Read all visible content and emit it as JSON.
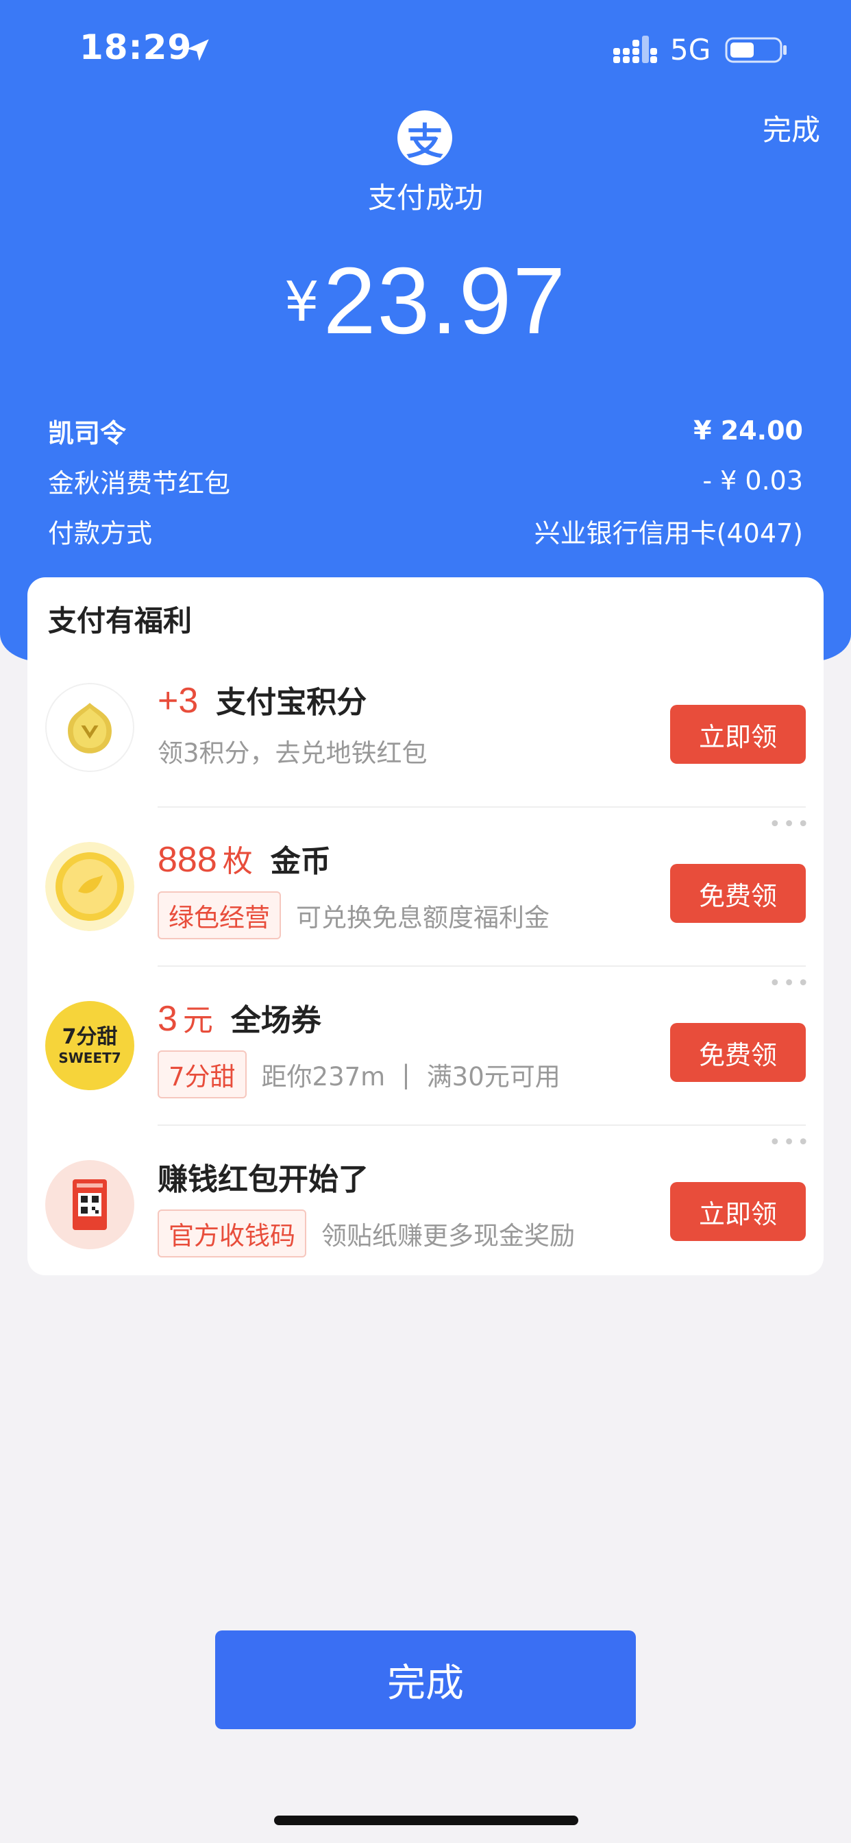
{
  "status_bar": {
    "time": "18:29",
    "network": "5G"
  },
  "header": {
    "done_label": "完成",
    "logo_char": "支",
    "status_text": "支付成功",
    "currency": "¥",
    "amount": "23.97"
  },
  "details": [
    {
      "label": "凯司令",
      "value": "¥ 24.00"
    },
    {
      "label": "金秋消费节红包",
      "value": "- ¥ 0.03"
    },
    {
      "label": "付款方式",
      "value": "兴业银行信用卡(4047)"
    }
  ],
  "benefits": {
    "title": "支付有福利",
    "items": [
      {
        "num": "+3",
        "unit": "",
        "name": "支付宝积分",
        "tag": "",
        "desc": "领3积分，去兑地铁红包",
        "extra": "",
        "button": "立即领"
      },
      {
        "num": "888",
        "unit": "枚",
        "name": "金币",
        "tag": "绿色经营",
        "desc": "可兑换免息额度福利金",
        "extra": "",
        "button": "免费领"
      },
      {
        "num": "3",
        "unit": "元",
        "name": "全场券",
        "tag": "7分甜",
        "desc": "距你237m",
        "extra": "满30元可用",
        "button": "免费领",
        "logo_text_top": "7分甜",
        "logo_text_bottom": "SWEET7"
      },
      {
        "num": "",
        "unit": "",
        "name": "赚钱红包开始了",
        "tag": "官方收钱码",
        "desc": "领贴纸赚更多现金奖励",
        "extra": "",
        "button": "立即领"
      }
    ]
  },
  "footer": {
    "done_label": "完成"
  },
  "colors": {
    "brand_blue": "#3a79f6",
    "accent_red": "#e84d3b"
  }
}
